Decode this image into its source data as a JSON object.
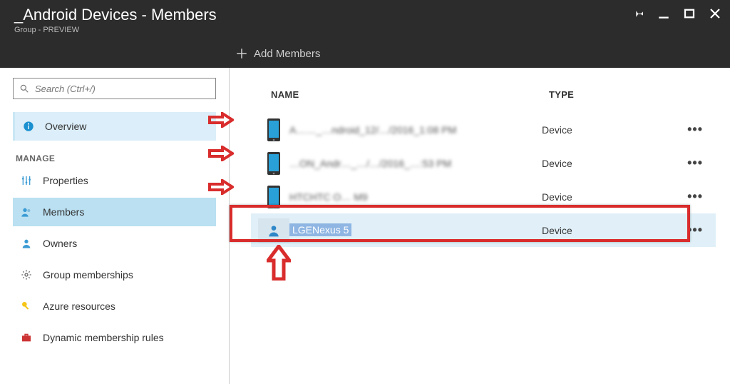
{
  "header": {
    "title": "_Android Devices - Members",
    "subtitle": "Group - PREVIEW"
  },
  "toolbar": {
    "add_members": "Add Members"
  },
  "search": {
    "placeholder": "Search (Ctrl+/)"
  },
  "sidebar": {
    "overview": "Overview",
    "manage_label": "MANAGE",
    "items": [
      {
        "label": "Properties"
      },
      {
        "label": "Members"
      },
      {
        "label": "Owners"
      },
      {
        "label": "Group memberships"
      },
      {
        "label": "Azure resources"
      },
      {
        "label": "Dynamic membership rules"
      }
    ]
  },
  "grid": {
    "col_name": "NAME",
    "col_type": "TYPE",
    "rows": [
      {
        "name": "A……_…ndroid_12/…/2016_1:08 PM",
        "type": "Device"
      },
      {
        "name": "…ON_Andr…_…/…/2016_…:53 PM",
        "type": "Device"
      },
      {
        "name": "HTCHTC O… M9",
        "type": "Device"
      },
      {
        "name": "LGENexus 5",
        "type": "Device"
      }
    ]
  }
}
